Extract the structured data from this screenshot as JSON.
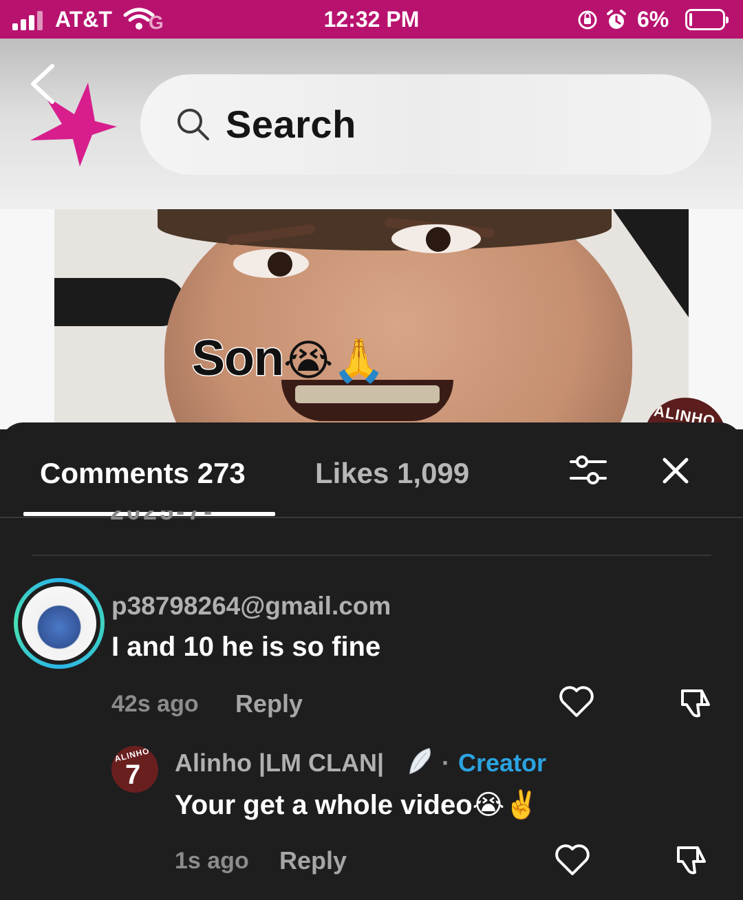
{
  "status_bar": {
    "carrier": "AT&T",
    "time": "12:32 PM",
    "battery_pct": "6%",
    "network_icon": "wifi-calling-icon",
    "background": "#b8126f"
  },
  "header": {
    "search_placeholder": "Search",
    "brand_color": "#d71e8c"
  },
  "video": {
    "caption": "Son",
    "caption_emoji": "😭🙏",
    "watermark": "ALINHO"
  },
  "comments_panel": {
    "tab_comments_label": "Comments",
    "tab_comments_count": "273",
    "tab_likes_label": "Likes",
    "tab_likes_count": "1,099",
    "comments": [
      {
        "username": "p38798264@gmail.com",
        "text": "I and 10 he is so fine",
        "time": "42s ago",
        "reply_label": "Reply",
        "avatar": "stitch-avatar",
        "replies": [
          {
            "username": "Alinho |LM CLAN|",
            "badge_icon": "angel-wing-icon",
            "separator": "·",
            "role": "Creator",
            "text": "Your get a whole video",
            "text_emoji": "😭✌️",
            "time": "1s ago",
            "reply_label": "Reply",
            "avatar_label": "ALINHO",
            "avatar_number": "7"
          }
        ]
      }
    ]
  },
  "colors": {
    "creator_accent": "#2ba3e0",
    "sheet_bg": "#1e1e1f"
  }
}
